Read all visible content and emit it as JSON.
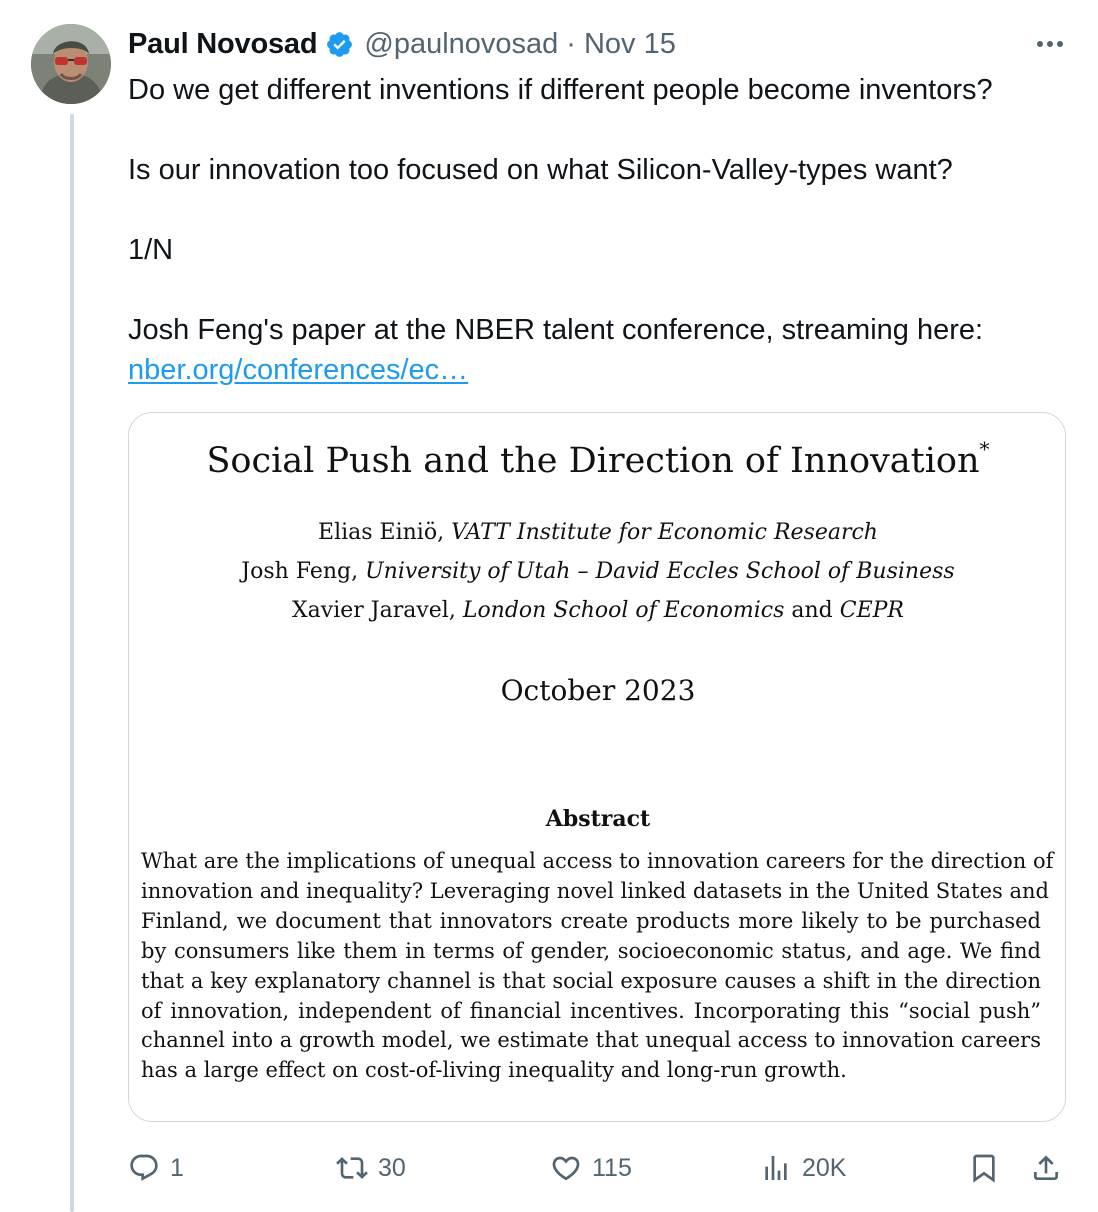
{
  "author": {
    "name": "Paul Novosad",
    "handle": "@paulnovosad",
    "separator": "·",
    "date": "Nov 15"
  },
  "tweet": {
    "lines": [
      "Do we get different inventions if different people become inventors?",
      "Is our innovation too focused on what Silicon-Valley-types want?",
      "1/N",
      "Josh Feng's paper at the NBER talent conference, streaming here:"
    ],
    "link_text": "nber.org/conferences/ec…"
  },
  "paper": {
    "title": "Social Push and the Direction of Innovation",
    "title_mark": "*",
    "authors": [
      {
        "name": "Elias Einiö,",
        "affiliation": "VATT Institute for Economic Research",
        "suffix": "",
        "extra": ""
      },
      {
        "name": "Josh Feng,",
        "affiliation": "University of Utah – David Eccles School of Business",
        "suffix": "",
        "extra": ""
      },
      {
        "name": "Xavier Jaravel,",
        "affiliation": "London School of Economics",
        "suffix": "and",
        "extra": "CEPR"
      }
    ],
    "date": "October 2023",
    "abstract_heading": "Abstract",
    "abstract_lines": [
      "What are the implications of unequal access to innovation careers for the direction of",
      "innovation and inequality? Leveraging novel linked datasets in the United States and",
      "Finland, we document that innovators create products more likely to be purchased",
      "by consumers like them in terms of gender, socioeconomic status, and age. We find",
      "that a key explanatory channel is that social exposure causes a shift in the direction",
      "of innovation, independent of financial incentives. Incorporating this “social push”",
      "channel into a growth model, we estimate that unequal access to innovation careers",
      "has a large effect on cost-of-living inequality and long-run growth."
    ]
  },
  "actions": {
    "replies": "1",
    "reposts": "30",
    "likes": "115",
    "views": "20K"
  },
  "colors": {
    "text": "#0f1419",
    "secondary": "#536471",
    "link": "#1d9bf0",
    "border": "#cfd9de"
  },
  "icons": [
    "reply-icon",
    "repost-icon",
    "like-icon",
    "views-icon",
    "bookmark-icon",
    "share-icon",
    "verified-badge-icon",
    "more-icon"
  ]
}
